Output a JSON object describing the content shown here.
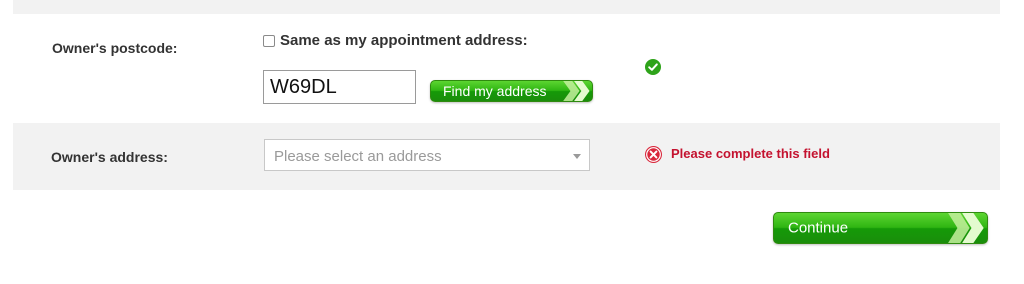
{
  "postcode_row": {
    "label": "Owner's postcode:",
    "same_address_checkbox": {
      "label": "Same as my appointment address:",
      "checked": false
    },
    "postcode_input": {
      "value": "W69DL"
    },
    "find_button_label": "Find my address",
    "status": "valid"
  },
  "address_row": {
    "label": "Owner's address:",
    "select": {
      "placeholder": "Please select an address"
    },
    "error_message": "Please complete this field"
  },
  "continue_button_label": "Continue",
  "colors": {
    "button_green": "#2fb512",
    "error_red": "#c4122f",
    "ok_green": "#2ea31a",
    "row_band": "#f2f2f2"
  },
  "icons": {
    "status_ok": "check-circle-icon",
    "status_error": "x-circle-icon",
    "button_arrows": "double-chevron-right-icon"
  }
}
